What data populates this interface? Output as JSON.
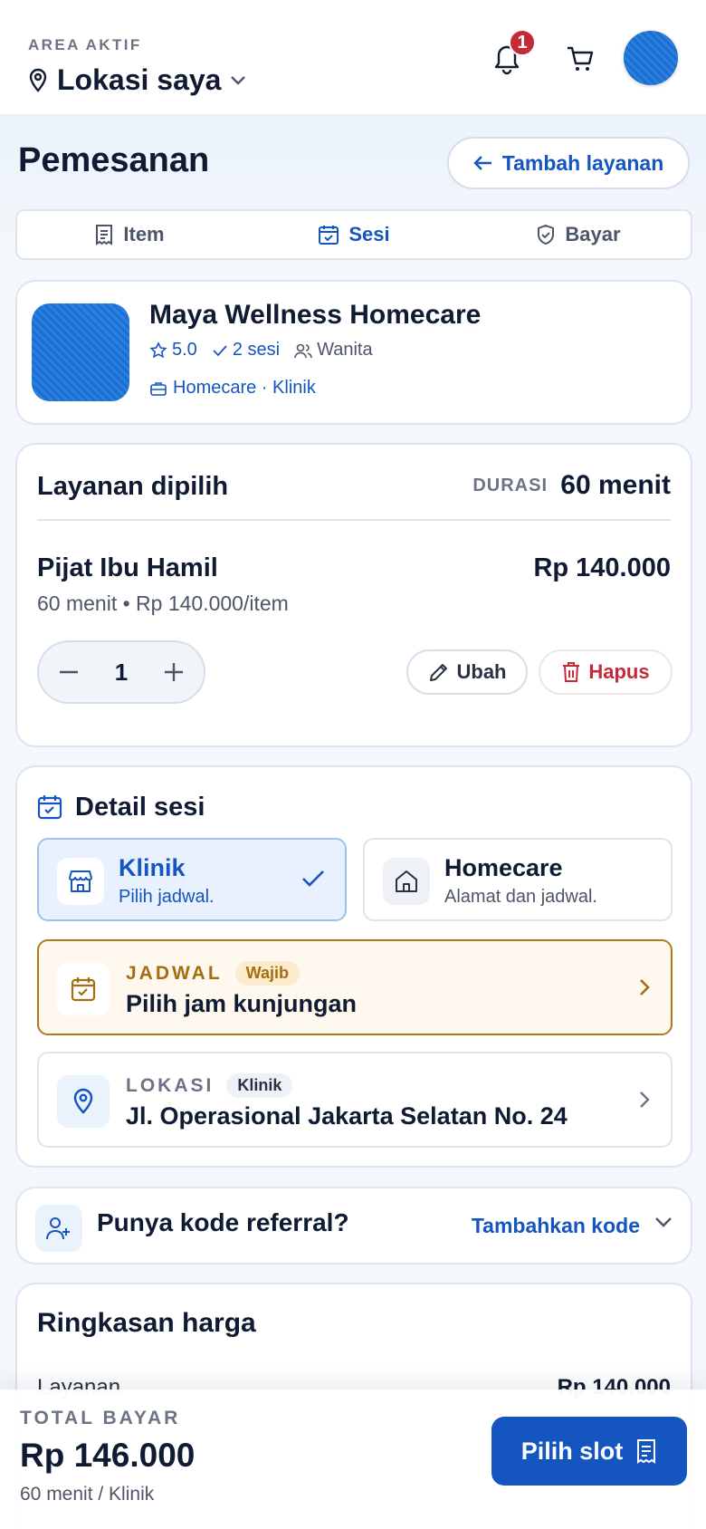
{
  "header": {
    "area_label": "AREA AKTIF",
    "location": "Lokasi saya",
    "notification_count": "1"
  },
  "page": {
    "title": "Pemesanan",
    "add_service_label": "Tambah layanan"
  },
  "steps": [
    {
      "label": "Item",
      "icon": "receipt-icon",
      "active": false
    },
    {
      "label": "Sesi",
      "icon": "calendar-check-icon",
      "active": true
    },
    {
      "label": "Bayar",
      "icon": "shield-check-icon",
      "active": false
    }
  ],
  "provider": {
    "name": "Maya Wellness Homecare",
    "rating": "5.0",
    "sessions": "2 sesi",
    "gender": "Wanita",
    "tags": "Homecare · Klinik"
  },
  "selected_service": {
    "title": "Layanan dipilih",
    "duration_label": "DURASI",
    "duration_value": "60 menit",
    "name": "Pijat Ibu Hamil",
    "price": "Rp 140.000",
    "sub": "60 menit • Rp 140.000/item",
    "quantity": "1",
    "edit_label": "Ubah",
    "delete_label": "Hapus"
  },
  "session": {
    "title": "Detail sesi",
    "options": [
      {
        "title": "Klinik",
        "sub": "Pilih jadwal.",
        "selected": true
      },
      {
        "title": "Homecare",
        "sub": "Alamat dan jadwal.",
        "selected": false
      }
    ],
    "schedule": {
      "label": "JADWAL",
      "pill": "Wajib",
      "value": "Pilih jam kunjungan"
    },
    "location": {
      "label": "LOKASI",
      "pill": "Klinik",
      "value": "Jl. Operasional Jakarta Selatan No. 24"
    }
  },
  "referral": {
    "title": "Punya kode referral?",
    "action": "Tambahkan kode"
  },
  "summary": {
    "title": "Ringkasan harga",
    "rows": [
      {
        "label": "Layanan",
        "value": "Rp 140.000"
      }
    ]
  },
  "footer": {
    "total_label": "TOTAL BAYAR",
    "total_value": "Rp 146.000",
    "total_sub": "60 menit / Klinik",
    "cta_label": "Pilih slot"
  },
  "colors": {
    "primary": "#1455c0",
    "danger": "#c42b38",
    "warning": "#a66d10",
    "text": "#0f1b33"
  }
}
